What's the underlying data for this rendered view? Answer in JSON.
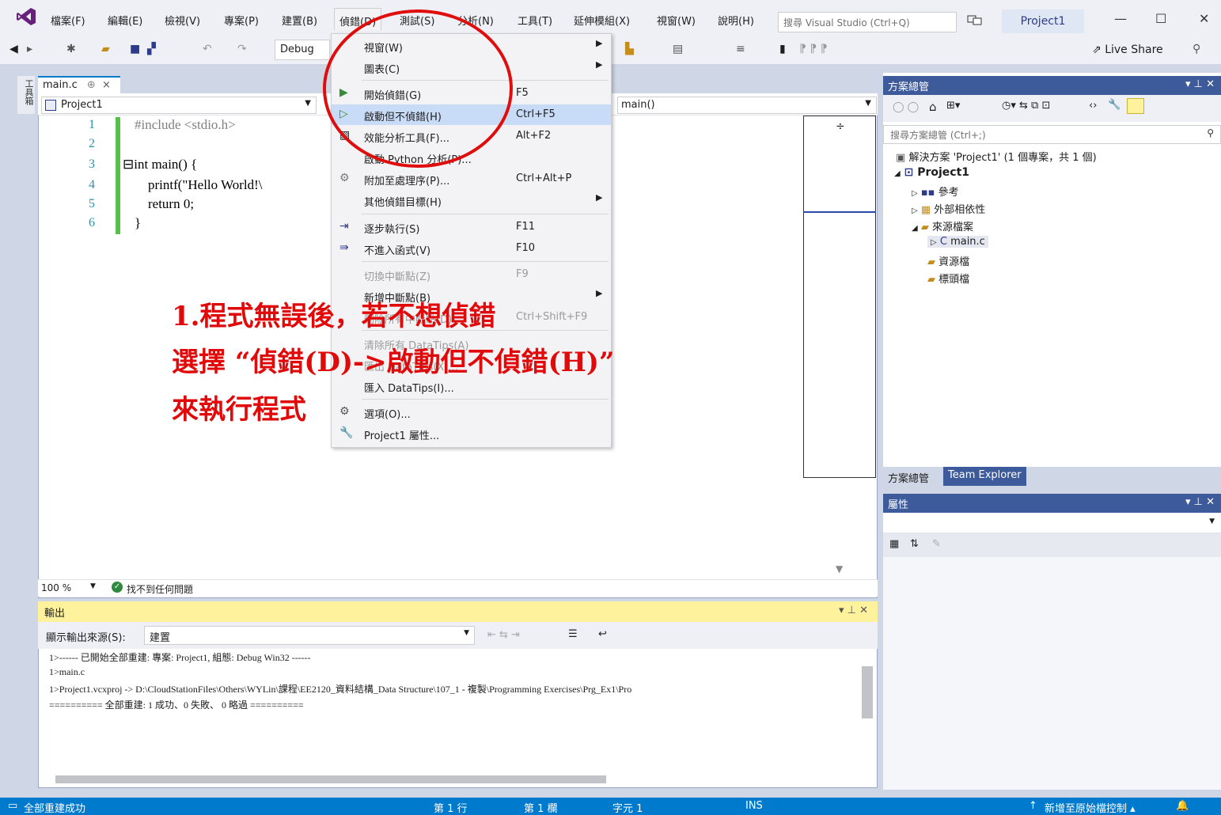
{
  "menubar": {
    "items": [
      "檔案(F)",
      "編輯(E)",
      "檢視(V)",
      "專案(P)",
      "建置(B)",
      "偵錯(D)",
      "測試(S)",
      "分析(N)",
      "工具(T)",
      "延伸模組(X)",
      "視窗(W)",
      "說明(H)"
    ],
    "search_placeholder": "搜尋 Visual Studio (Ctrl+Q)",
    "project_title": "Project1",
    "window_buttons": [
      "—",
      "☐",
      "✕"
    ]
  },
  "toolbar": {
    "config": "Debug",
    "live_share": "Live Share"
  },
  "toolbox": {
    "label": "工具箱"
  },
  "editor": {
    "tab_label": "main.c",
    "tab_pin": "⊕",
    "tab_close": "×",
    "nav_project": "Project1",
    "nav_function": "main()",
    "lines": [
      {
        "num": "1",
        "code": "#include <stdio.h>"
      },
      {
        "num": "2",
        "code": ""
      },
      {
        "num": "3",
        "code": "⊟int main() {"
      },
      {
        "num": "4",
        "code": "    printf(\"Hello World!\\"
      },
      {
        "num": "5",
        "code": "    return 0;"
      },
      {
        "num": "6",
        "code": "}"
      }
    ],
    "zoom": "100 %",
    "status": "找不到任何問題"
  },
  "debug_menu": {
    "items": [
      {
        "label": "視窗(W)",
        "shortcut": "",
        "submenu": true
      },
      {
        "label": "圖表(C)",
        "shortcut": "",
        "submenu": true
      },
      {
        "label": "開始偵錯(G)",
        "shortcut": "F5",
        "icon": "play-icon"
      },
      {
        "label": "啟動但不偵錯(H)",
        "shortcut": "Ctrl+F5",
        "icon": "play-outline-icon",
        "highlight": true
      },
      {
        "label": "效能分析工具(F)...",
        "shortcut": "Alt+F2",
        "icon": "perf-icon"
      },
      {
        "label": "啟動 Python 分析(P)...",
        "shortcut": ""
      },
      {
        "label": "附加至處理序(P)...",
        "shortcut": "Ctrl+Alt+P",
        "icon": "gear-icon"
      },
      {
        "label": "其他偵錯目標(H)",
        "shortcut": "",
        "submenu": true
      },
      {
        "label": "逐步執行(S)",
        "shortcut": "F11",
        "icon": "step-into-icon"
      },
      {
        "label": "不進入函式(V)",
        "shortcut": "F10",
        "icon": "step-over-icon"
      },
      {
        "label": "切換中斷點(Z)",
        "shortcut": "F9",
        "disabled": true
      },
      {
        "label": "新增中斷點(B)",
        "shortcut": "",
        "submenu": true
      },
      {
        "label": "刪除所有中斷點(D)",
        "shortcut": "Ctrl+Shift+F9",
        "disabled": true
      },
      {
        "label": "清除所有 DataTips(A)",
        "shortcut": "",
        "disabled": true
      },
      {
        "label": "匯出 DataTips(X)...",
        "shortcut": "",
        "disabled": true
      },
      {
        "label": "匯入 DataTips(I)...",
        "shortcut": ""
      },
      {
        "label": "選項(O)...",
        "shortcut": "",
        "icon": "gear-icon"
      },
      {
        "label": "Project1 屬性...",
        "shortcut": "",
        "icon": "wrench-icon"
      }
    ]
  },
  "annotation": {
    "line1": "1.程式無誤後，若不想偵錯",
    "line2": "選擇 “偵錯(D)->啟動但不偵錯(H)”",
    "line3": "來執行程式"
  },
  "solution_explorer": {
    "title": "方案總管",
    "search_placeholder": "搜尋方案總管 (Ctrl+;)",
    "solution": "解決方案 'Project1' (1 個專案，共 1 個)",
    "project": "Project1",
    "nodes": [
      "參考",
      "外部相依性",
      "來源檔案",
      "main.c",
      "資源檔",
      "標頭檔"
    ],
    "tabs": [
      "方案總管",
      "Team Explorer"
    ]
  },
  "properties": {
    "title": "屬性"
  },
  "output": {
    "title": "輸出",
    "source_label": "顯示輸出來源(S):",
    "source_value": "建置",
    "lines": [
      "1>------ 已開始全部重建: 專案: Project1, 組態: Debug Win32 ------",
      "1>main.c",
      "1>Project1.vcxproj -> D:\\CloudStationFiles\\Others\\WYLin\\課程\\EE2120_資料結構_Data Structure\\107_1 - 複製\\Programming Exercises\\Prg_Ex1\\Pro",
      "========== 全部重建: 1 成功、0 失敗、 0 略過 =========="
    ]
  },
  "statusbar": {
    "message": "全部重建成功",
    "line": "第 1 行",
    "col": "第 1 欄",
    "char": "字元 1",
    "mode": "INS",
    "source_control": "新增至原始檔控制 ▴"
  },
  "colors": {
    "accent": "#007acc",
    "annotation_red": "#e00d0d",
    "panel_header": "#3d5a9a",
    "output_header": "#fff29d"
  }
}
